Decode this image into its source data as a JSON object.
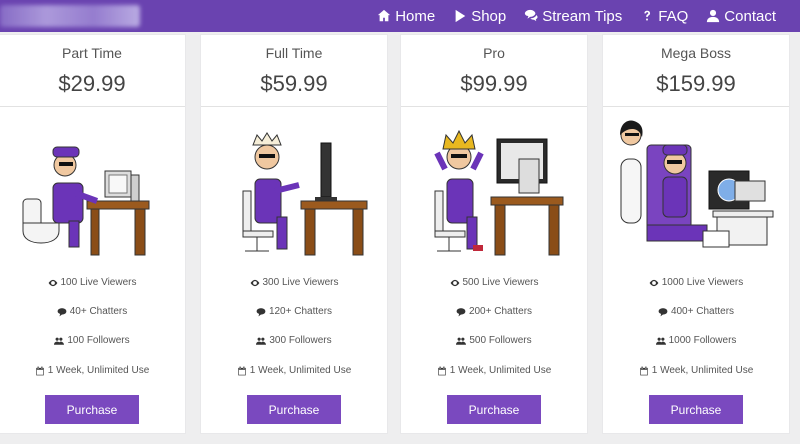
{
  "nav": {
    "items": [
      {
        "label": "Home",
        "icon": "home-icon"
      },
      {
        "label": "Shop",
        "icon": "play-icon"
      },
      {
        "label": "Stream Tips",
        "icon": "chat-icon"
      },
      {
        "label": "FAQ",
        "icon": "question-icon"
      },
      {
        "label": "Contact",
        "icon": "user-icon"
      }
    ]
  },
  "plans": [
    {
      "name": "Part Time",
      "price": "$29.99",
      "viewers": "100 Live Viewers",
      "chatters": "40+ Chatters",
      "followers": "100 Followers",
      "duration": "1 Week, Unlimited Use",
      "button": "Purchase"
    },
    {
      "name": "Full Time",
      "price": "$59.99",
      "viewers": "300 Live Viewers",
      "chatters": "120+ Chatters",
      "followers": "300 Followers",
      "duration": "1 Week, Unlimited Use",
      "button": "Purchase"
    },
    {
      "name": "Pro",
      "price": "$99.99",
      "viewers": "500 Live Viewers",
      "chatters": "200+ Chatters",
      "followers": "500 Followers",
      "duration": "1 Week, Unlimited Use",
      "button": "Purchase"
    },
    {
      "name": "Mega Boss",
      "price": "$159.99",
      "viewers": "1000 Live Viewers",
      "chatters": "400+ Chatters",
      "followers": "1000 Followers",
      "duration": "1 Week, Unlimited Use",
      "button": "Purchase"
    }
  ],
  "colors": {
    "accent": "#6a43b0",
    "button": "#7a49bf",
    "background": "#eeeeef"
  }
}
